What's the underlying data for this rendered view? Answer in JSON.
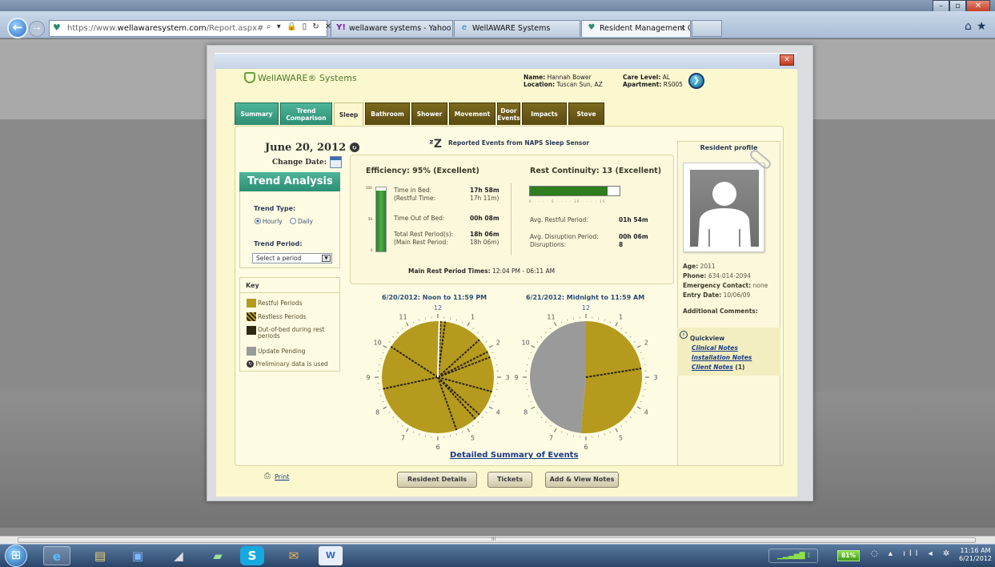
{
  "browser": {
    "url_prefix": "https://www.",
    "url_domain": "wellawaresystem.com",
    "url_path": "/Report.aspx#",
    "address_controls": "⌕ ▾ 🔒 ▯ ↻ ✕",
    "tabs": [
      {
        "label": "wellaware systems - Yahoo! Se...",
        "icon": "yahoo-icon"
      },
      {
        "label": "WellAWARE Systems",
        "icon": "ie-icon"
      },
      {
        "label": "Resident Management Over...",
        "icon": "wellaware-icon",
        "active": true
      }
    ]
  },
  "header": {
    "logo_text": "WellAWARE® Systems",
    "name_label": "Name:",
    "name_value": "Hannah Bower",
    "location_label": "Location:",
    "location_value": "Tuscan Sun, AZ",
    "care_label": "Care Level:",
    "care_value": "AL",
    "apartment_label": "Apartment:",
    "apartment_value": "RS005"
  },
  "tabs": [
    {
      "label": "Summary",
      "style": "teal"
    },
    {
      "label": "Trend\nComparison",
      "style": "teal"
    },
    {
      "label": "Sleep",
      "style": "current"
    },
    {
      "label": "Bathroom",
      "style": "brown"
    },
    {
      "label": "Shower",
      "style": "brown"
    },
    {
      "label": "Movement",
      "style": "brown"
    },
    {
      "label": "Door\nEvents",
      "style": "brown"
    },
    {
      "label": "Impacts",
      "style": "brown"
    },
    {
      "label": "Stove",
      "style": "brown"
    }
  ],
  "left": {
    "date": "June 20, 2012",
    "change_date": "Change Date:",
    "trend_title": "Trend Analysis",
    "trend_type": "Trend Type:",
    "hourly": "Hourly",
    "daily": "Daily",
    "trend_period": "Trend Period:",
    "period_placeholder": "Select a period",
    "key_title": "Key",
    "key": [
      {
        "label": "Restful Periods",
        "color": "#b59a1e"
      },
      {
        "label": "Restless Periods",
        "color": "#3a3310"
      },
      {
        "label": "Out-of-bed during rest",
        "label2": "periods",
        "color": "#2e2a12"
      },
      {
        "label": "Update Pending",
        "color": "#9a9a9a"
      },
      {
        "label": "Preliminary data is used",
        "color": "#333333"
      }
    ]
  },
  "summary": {
    "sensor_title": "Reported Events from NAPS Sleep Sensor",
    "efficiency": "Efficiency: 95% (Excellent)",
    "efficiency_fraction": 0.95,
    "bar_top": "100",
    "bar_mid": "50",
    "bar_bottom": "0",
    "time_in_bed_label": "Time in Bed:",
    "time_in_bed": "17h 58m",
    "restful_time_label": "(Restful Time:",
    "restful_time": "17h 11m)",
    "time_out_label": "Time Out of Bed:",
    "time_out": "00h 08m",
    "total_rest_label": "Total Rest Period(s):",
    "total_rest": "18h 06m",
    "main_rest_label": "(Main Rest Period:",
    "main_rest": "18h 06m)",
    "rest_continuity": "Rest Continuity: 13 (Excellent)",
    "rest_continuity_value": 13,
    "rest_continuity_max": 15,
    "rest_ticks": "0 · · · · 5 · · · · 10 · · · · 15",
    "avg_restful_label": "Avg. Restful Period:",
    "avg_restful": "01h 54m",
    "avg_disruption_label": "Avg. Disruption Period:",
    "avg_disruption": "00h 06m",
    "disruptions_label": "Disruptions:",
    "disruptions": "8",
    "main_rest_times_label": "Main Rest Period Times:",
    "main_rest_times": "12:04 PM - 06:11 AM"
  },
  "clocks": [
    {
      "title": "6/20/2012: Noon to 11:59 PM",
      "segments": [
        {
          "from": 0,
          "to": 12,
          "kind": "restful"
        }
      ],
      "marks": [
        0.1,
        0.25,
        1.6,
        2.1,
        2.3,
        3.5,
        4.4,
        4.6,
        5.35,
        8.6,
        10.1
      ]
    },
    {
      "title": "6/21/2012: Midnight to 11:59 AM",
      "segments": [
        {
          "from": 0,
          "to": 6.18,
          "kind": "restful"
        },
        {
          "from": 6.18,
          "to": 12,
          "kind": "pending"
        }
      ],
      "marks": [
        2.7
      ]
    }
  ],
  "clock_numbers": [
    "12",
    "1",
    "2",
    "3",
    "4",
    "5",
    "6",
    "7",
    "8",
    "9",
    "10",
    "11"
  ],
  "detailed_link": "Detailed Summary of Events",
  "profile": {
    "title": "Resident profile",
    "age_label": "Age:",
    "age": "2011",
    "phone_label": "Phone:",
    "phone": "634-014-2094",
    "emergency_label": "Emergency Contact:",
    "emergency": "none",
    "entry_label": "Entry Date:",
    "entry": "10/06/09",
    "comments_label": "Additional Comments:",
    "quickview": "Quickview",
    "clinical": "Clinical Notes",
    "installation": "Installation Notes",
    "client": "Client Notes",
    "client_count": "(1)"
  },
  "footer": {
    "print": "Print",
    "resident_details": "Resident Details",
    "tickets": "Tickets",
    "add_notes": "Add & View Notes"
  },
  "taskbar": {
    "battery": "81%",
    "time": "11:16 AM",
    "date": "6/21/2012",
    "scroll_glyph": "III"
  },
  "colors": {
    "restful": "#b59a1e",
    "pending": "#9a9a9a",
    "restless": "#2b2510",
    "accent_teal": "#2c8e73",
    "tab_brown": "#6a5818"
  }
}
